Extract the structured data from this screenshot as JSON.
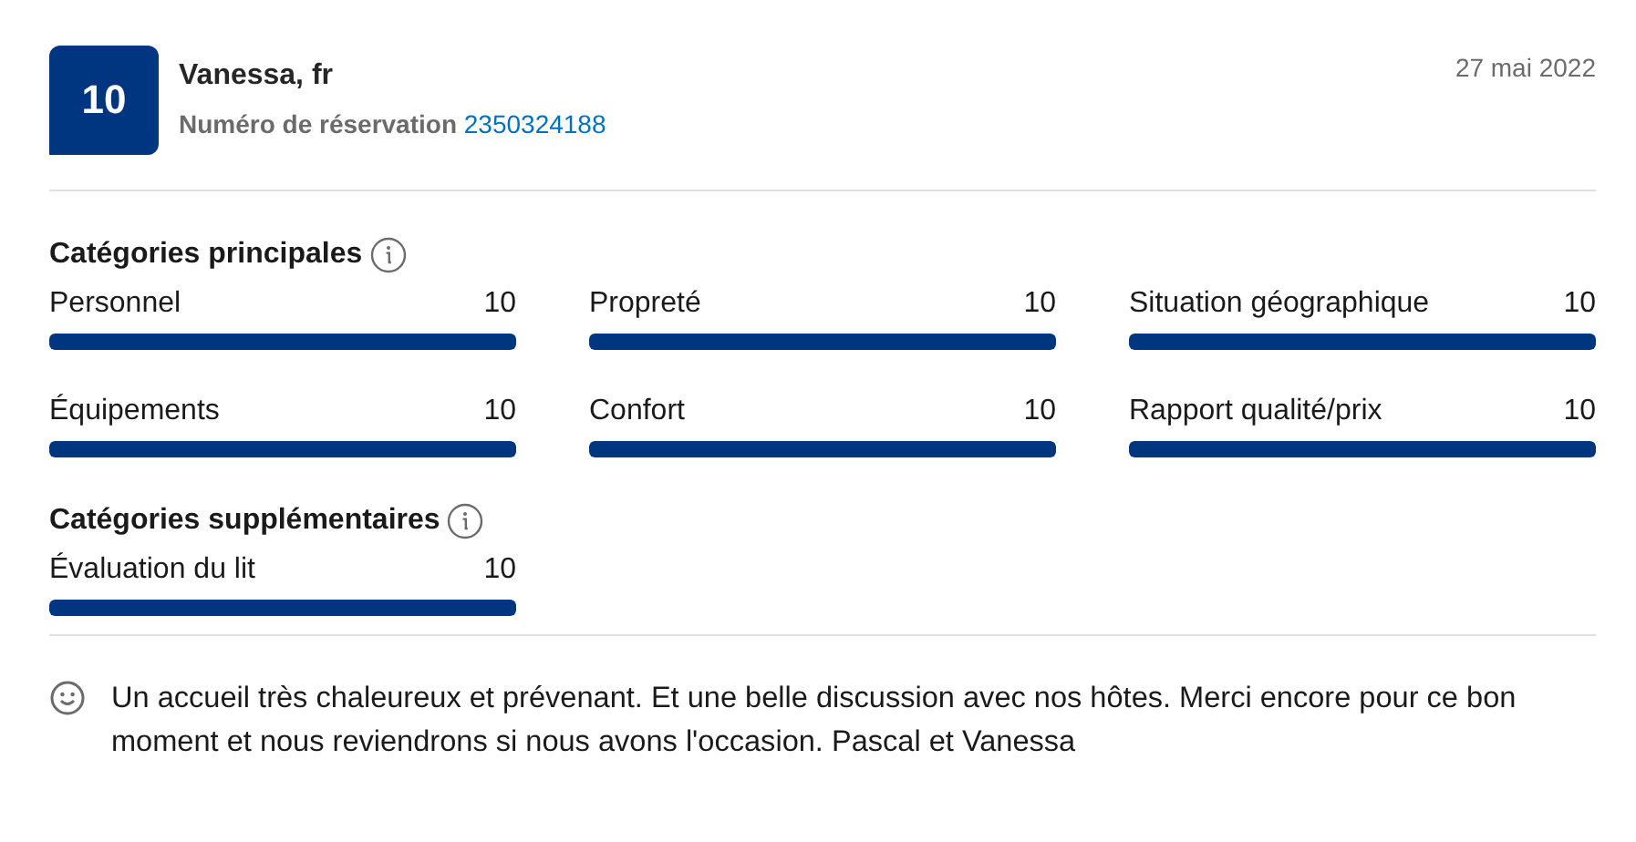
{
  "review": {
    "score": "10",
    "reviewer": "Vanessa, fr",
    "booking_label": "Numéro de réservation",
    "booking_number": "2350324188",
    "date": "27 mai 2022"
  },
  "sections": [
    {
      "title": "Catégories principales",
      "categories": [
        {
          "name": "Personnel",
          "score": "10",
          "level": 1
        },
        {
          "name": "Propreté",
          "score": "10",
          "level": 1
        },
        {
          "name": "Situation géographique",
          "score": "10",
          "level": 1
        },
        {
          "name": "Équipements",
          "score": "10",
          "level": 1
        },
        {
          "name": "Confort",
          "score": "10",
          "level": 1
        },
        {
          "name": "Rapport qualité/prix",
          "score": "10",
          "level": 1
        }
      ]
    },
    {
      "title": "Catégories supplémentaires",
      "categories": [
        {
          "name": "Évaluation du lit",
          "score": "10",
          "level": 1
        }
      ]
    }
  ],
  "comment": {
    "kind": "positive",
    "text": "Un accueil très chaleureux et prévenant. Et une belle discussion avec nos hôtes. Merci encore pour ce bon moment et nous reviendrons si nous avons l'occasion. Pascal et Vanessa"
  }
}
